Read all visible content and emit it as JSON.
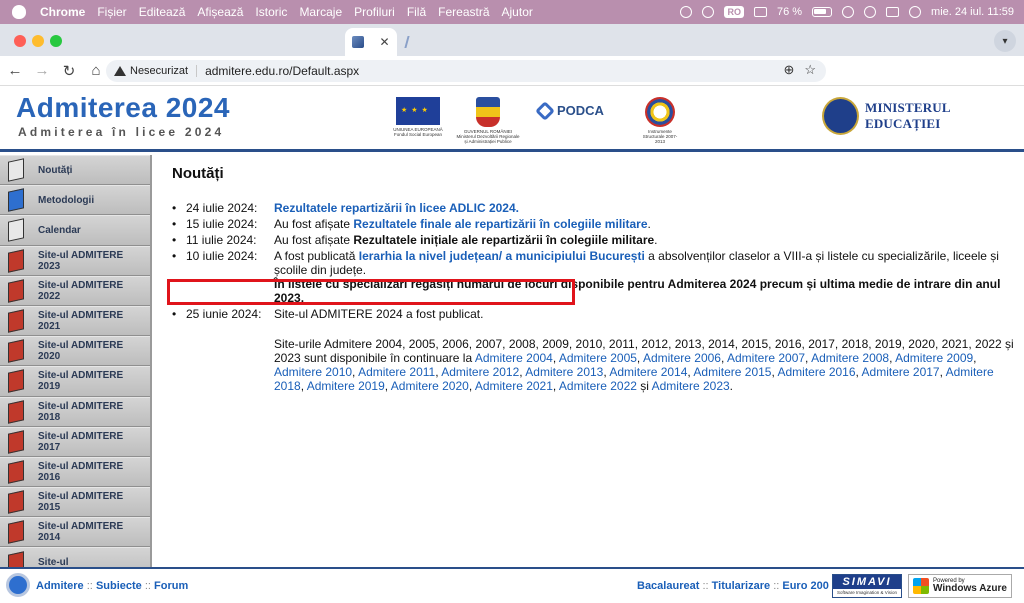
{
  "menubar": {
    "app": "Chrome",
    "items": [
      "Fișier",
      "Editează",
      "Afișează",
      "Istoric",
      "Marcaje",
      "Profiluri",
      "Filă",
      "Fereastră",
      "Ajutor"
    ],
    "input_source": "RO",
    "battery": "76 %",
    "datetime": "mie. 24 iul.  11:59"
  },
  "browser": {
    "tab_close": "✕",
    "security_label": "Nesecurizat",
    "url": "admitere.edu.ro/Default.aspx"
  },
  "header": {
    "title": "Admiterea 2024",
    "subtitle": "Admiterea în licee 2024",
    "logos": [
      {
        "name": "eu-flag",
        "label": "UNIUNEA EUROPEANĂ Fondul Social European"
      },
      {
        "name": "romania-coat",
        "label": "GUVERNUL ROMÂNIEI Ministerul Dezvoltării Regionale și Administrației Publice"
      },
      {
        "name": "podca",
        "label": "PODCA"
      },
      {
        "name": "instrumente-structurale",
        "label": "Instrumente Structurale 2007-2013"
      }
    ],
    "ministry": "MINISTERUL EDUCAȚIEI"
  },
  "sidebar": {
    "items": [
      {
        "label": "Noutăți",
        "icon": "book-grey"
      },
      {
        "label": "Metodologii",
        "icon": "book-blue"
      },
      {
        "label": "Calendar",
        "icon": "book-grey"
      },
      {
        "label": "Site-ul ADMITERE 2023",
        "icon": "book-red"
      },
      {
        "label": "Site-ul ADMITERE 2022",
        "icon": "book-red"
      },
      {
        "label": "Site-ul ADMITERE 2021",
        "icon": "book-red"
      },
      {
        "label": "Site-ul ADMITERE 2020",
        "icon": "book-red"
      },
      {
        "label": "Site-ul ADMITERE 2019",
        "icon": "book-red"
      },
      {
        "label": "Site-ul ADMITERE 2018",
        "icon": "book-red"
      },
      {
        "label": "Site-ul ADMITERE 2017",
        "icon": "book-red"
      },
      {
        "label": "Site-ul ADMITERE 2016",
        "icon": "book-red"
      },
      {
        "label": "Site-ul ADMITERE 2015",
        "icon": "book-red"
      },
      {
        "label": "Site-ul ADMITERE 2014",
        "icon": "book-red"
      },
      {
        "label": "Site-ul",
        "icon": "book-red"
      }
    ]
  },
  "content": {
    "heading": "Noutăți",
    "news": [
      {
        "bullet": "•",
        "date": "24 iulie 2024:",
        "pre": "",
        "link": "Rezultatele repartizării în licee ADLIC 2024",
        "post": "."
      },
      {
        "bullet": "•",
        "date": "15 iulie 2024:",
        "pre": "Au fost afișate ",
        "link": "Rezultatele finale ale repartizării în colegiile militare",
        "post": "."
      },
      {
        "bullet": "•",
        "date": "11 iulie 2024:",
        "pre": "Au fost afișate ",
        "bold": "Rezultatele inițiale ale repartizării în colegiile militare",
        "post": "."
      },
      {
        "bullet": "•",
        "date": "10 iulie 2024:",
        "pre": " A fost publicată ",
        "link": "Ierarhia la nivel județean/ a municipiului București",
        "post": " a absolvenților claselor a VIII-a și listele cu specializările, liceele și școlile din județe.",
        "note": "În listele cu specializări regăsiți numărul de locuri disponibile pentru Admiterea 2024 precum și ultima medie de intrare din anul 2023."
      },
      {
        "bullet": "•",
        "date": "25 iunie 2024:",
        "pre": "Site-ul ADMITERE 2024 a fost publicat."
      }
    ],
    "archive": {
      "pre": "Site-urile Admitere 2004, 2005, 2006, 2007, 2008, 2009, 2010, 2011, 2012, 2013, 2014, 2015, 2016, 2017, 2018, 2019, 2020, 2021, 2022 și 2023 sunt disponibile în continuare la ",
      "links": [
        "Admitere 2004",
        "Admitere 2005",
        "Admitere 2006",
        "Admitere 2007",
        "Admitere 2008",
        "Admitere 2009",
        "Admitere 2010",
        "Admitere 2011",
        "Admitere 2012",
        "Admitere 2013",
        "Admitere 2014",
        "Admitere 2015",
        "Admitere 2016",
        "Admitere 2017",
        "Admitere 2018",
        "Admitere 2019",
        "Admitere 2020",
        "Admitere 2021",
        "Admitere 2022"
      ],
      "and": " și ",
      "last": "Admitere 2023",
      "end": "."
    }
  },
  "footer": {
    "left_links": [
      "Admitere",
      "Subiecte",
      "Forum"
    ],
    "right_links": [
      "Bacalaureat",
      "Titularizare",
      "Euro 200"
    ],
    "separator": "::",
    "simavi": "SIMAVI",
    "simavi_tag": "Software Imagination & Vision",
    "azure_small": "Powered by",
    "azure": "Windows Azure"
  }
}
